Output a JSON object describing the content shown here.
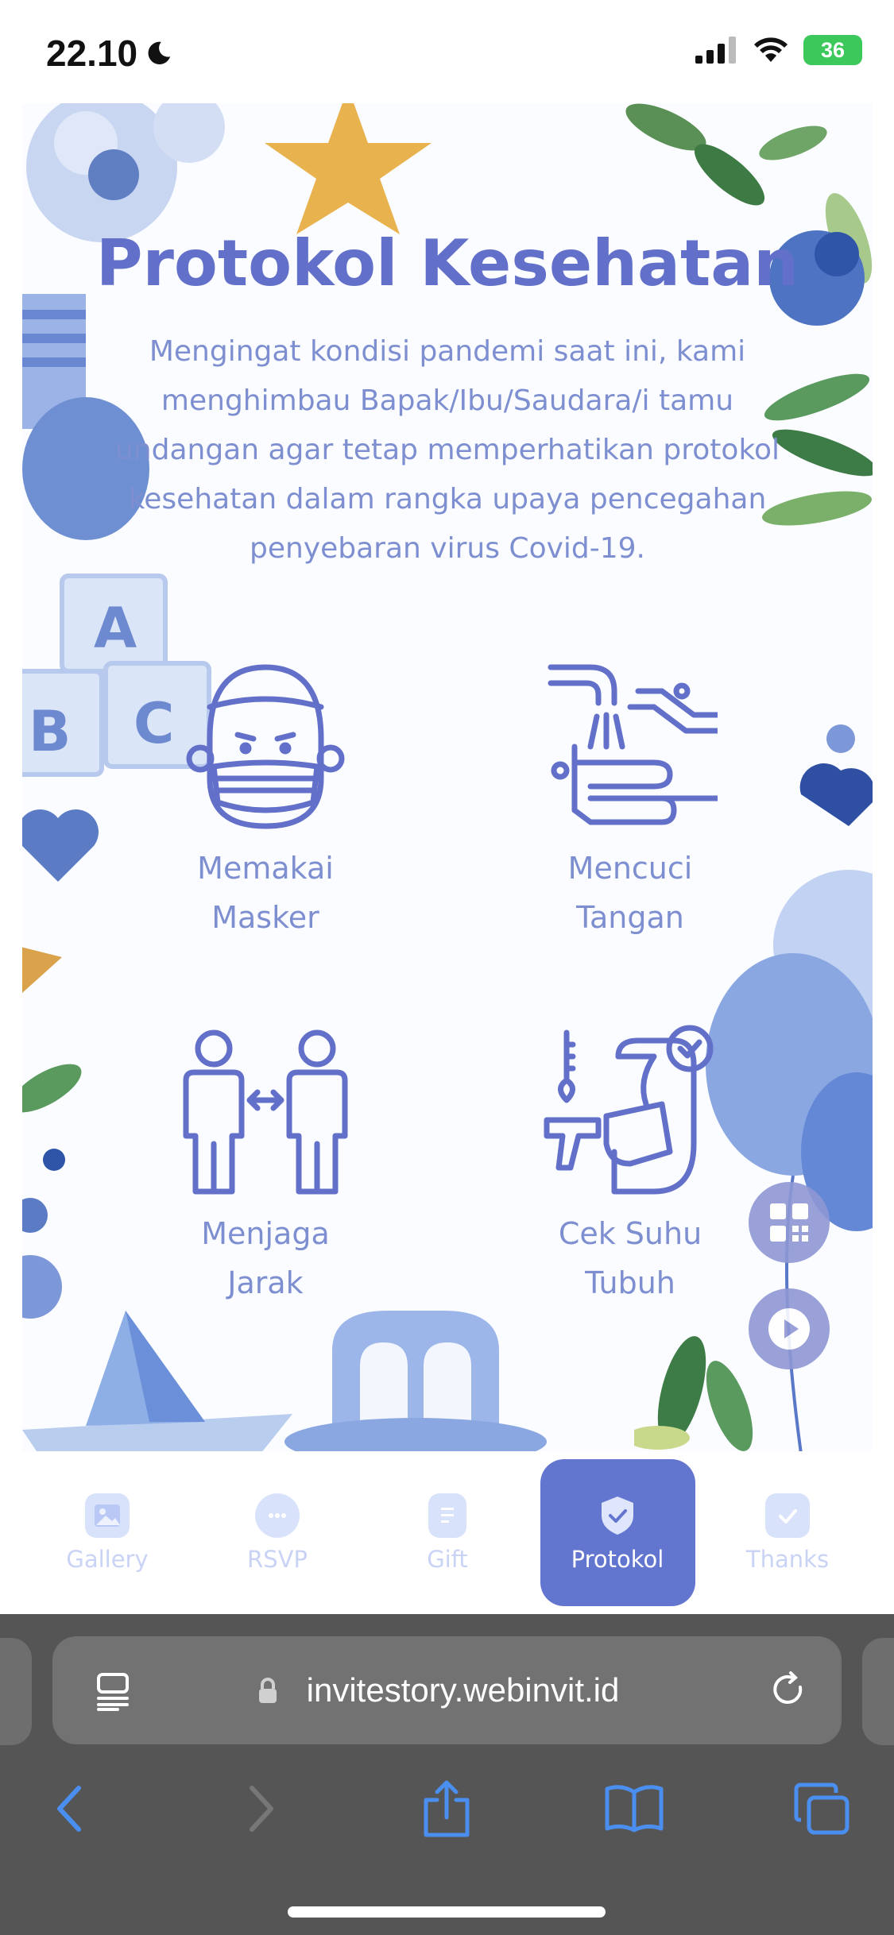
{
  "status_bar": {
    "time": "22.10",
    "battery": "36"
  },
  "page": {
    "title": "Protokol Kesehatan",
    "description": "Mengingat kondisi pandemi saat ini, kami menghimbau Bapak/Ibu/Saudara/i tamu undangan agar tetap memperhatikan protokol kesehatan dalam rangka upaya pencegahan penyebaran virus Covid-19.",
    "protocols": [
      {
        "line1": "Memakai",
        "line2": "Masker",
        "icon": "face-mask-icon"
      },
      {
        "line1": "Mencuci",
        "line2": "Tangan",
        "icon": "hand-washing-icon"
      },
      {
        "line1": "Menjaga",
        "line2": "Jarak",
        "icon": "social-distance-icon"
      },
      {
        "line1": "Cek Suhu",
        "line2": "Tubuh",
        "icon": "temperature-check-icon"
      }
    ],
    "decor_letters": [
      "A",
      "B",
      "C"
    ]
  },
  "floating_buttons": [
    {
      "icon": "qr-code-icon"
    },
    {
      "icon": "play-icon"
    }
  ],
  "bottom_nav": {
    "items": [
      {
        "label": "Gallery",
        "icon": "image-icon",
        "active": false
      },
      {
        "label": "RSVP",
        "icon": "chat-bubble-icon",
        "active": false
      },
      {
        "label": "Gift",
        "icon": "document-icon",
        "active": false
      },
      {
        "label": "Protokol",
        "icon": "shield-check-icon",
        "active": true
      },
      {
        "label": "Thanks",
        "icon": "check-icon",
        "active": false
      }
    ]
  },
  "browser": {
    "url": "invitestory.webinvit.id"
  },
  "colors": {
    "primary": "#6270c9",
    "text_soft": "#7d8fd0",
    "nav_active": "#6275cf",
    "battery": "#3cc85a",
    "safari_bg": "#555555",
    "safari_blue": "#4a8ff0"
  }
}
